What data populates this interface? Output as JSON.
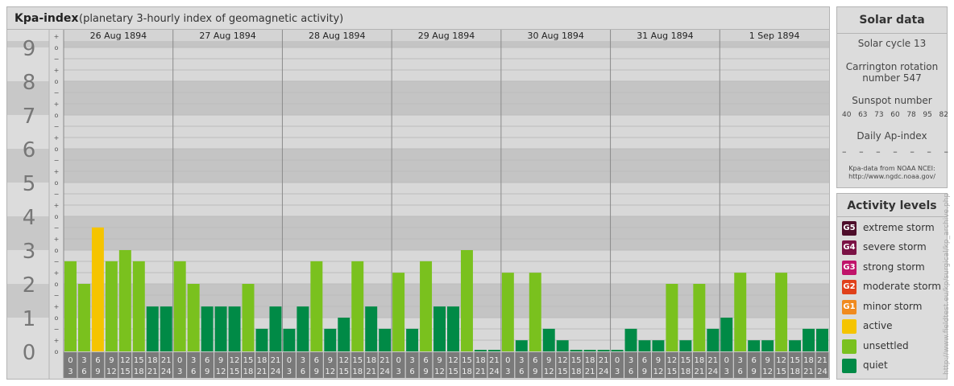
{
  "kpa_panel": {
    "title": "Kpa-index",
    "subtitle": "(planetary 3-hourly index of geomagnetic activity)"
  },
  "solar_panel": {
    "title": "Solar data",
    "solar_cycle": "Solar cycle 13",
    "carrington_line1": "Carrington rotation",
    "carrington_line2": "number 547",
    "sunspot_label": "Sunspot number",
    "sunspot_values": [
      "40",
      "63",
      "73",
      "60",
      "78",
      "95",
      "82"
    ],
    "ap_label": "Daily Ap-index",
    "ap_values": [
      "–",
      "–",
      "–",
      "–",
      "–",
      "–",
      "–"
    ],
    "source_line1": "Kpa-data from NOAA NCEI:",
    "source_line2": "http://www.ngdc.noaa.gov/"
  },
  "legend": {
    "title": "Activity levels",
    "items": [
      {
        "badge": "G5",
        "label": "extreme storm",
        "color": "#4d0d2a"
      },
      {
        "badge": "G4",
        "label": "severe storm",
        "color": "#7a1245"
      },
      {
        "badge": "G3",
        "label": "strong storm",
        "color": "#c0136a"
      },
      {
        "badge": "G2",
        "label": "moderate storm",
        "color": "#e0401a"
      },
      {
        "badge": "G1",
        "label": "minor storm",
        "color": "#f08a1e"
      },
      {
        "badge": "",
        "label": "active",
        "color": "#f5c400"
      },
      {
        "badge": "",
        "label": "unsettled",
        "color": "#7ac11e"
      },
      {
        "badge": "",
        "label": "quiet",
        "color": "#008a46"
      }
    ]
  },
  "credit_url": "http://www.fieldtest.eu/kp/surgical/kp_archive.php",
  "chart_data": {
    "type": "bar",
    "title": "Kpa-index",
    "y_ticks": [
      "0",
      "1",
      "2",
      "3",
      "4",
      "5",
      "6",
      "7",
      "8",
      "9"
    ],
    "ylim": [
      0,
      9.67
    ],
    "sub_ticks": [
      "o",
      "+",
      "−"
    ],
    "days": [
      "26 Aug 1894",
      "27 Aug 1894",
      "28 Aug 1894",
      "29 Aug 1894",
      "30 Aug 1894",
      "31 Aug 1894",
      "1 Sep 1894"
    ],
    "interval_start_labels": [
      "0",
      "3",
      "6",
      "9",
      "12",
      "15",
      "18",
      "21"
    ],
    "interval_end_labels": [
      "3",
      "6",
      "9",
      "12",
      "15",
      "18",
      "21",
      "24"
    ],
    "values": [
      [
        2.67,
        2.0,
        3.67,
        2.67,
        3.0,
        2.67,
        1.33,
        1.33
      ],
      [
        2.67,
        2.0,
        1.33,
        1.33,
        1.33,
        2.0,
        0.67,
        1.33
      ],
      [
        0.67,
        1.33,
        2.67,
        0.67,
        1.0,
        2.67,
        1.33,
        0.67
      ],
      [
        2.33,
        0.67,
        2.67,
        1.33,
        1.33,
        3.0,
        0.0,
        0.0
      ],
      [
        2.33,
        0.33,
        2.33,
        0.67,
        0.33,
        0.0,
        0.0,
        0.0
      ],
      [
        0.0,
        0.67,
        0.33,
        0.33,
        2.0,
        0.33,
        2.0,
        0.67
      ],
      [
        1.0,
        2.33,
        0.33,
        0.33,
        2.33,
        0.33,
        0.67,
        0.67
      ]
    ],
    "level_colors": {
      "quiet": "#008a46",
      "unsettled": "#7ac11e",
      "active": "#f5c400"
    },
    "grid": true
  }
}
